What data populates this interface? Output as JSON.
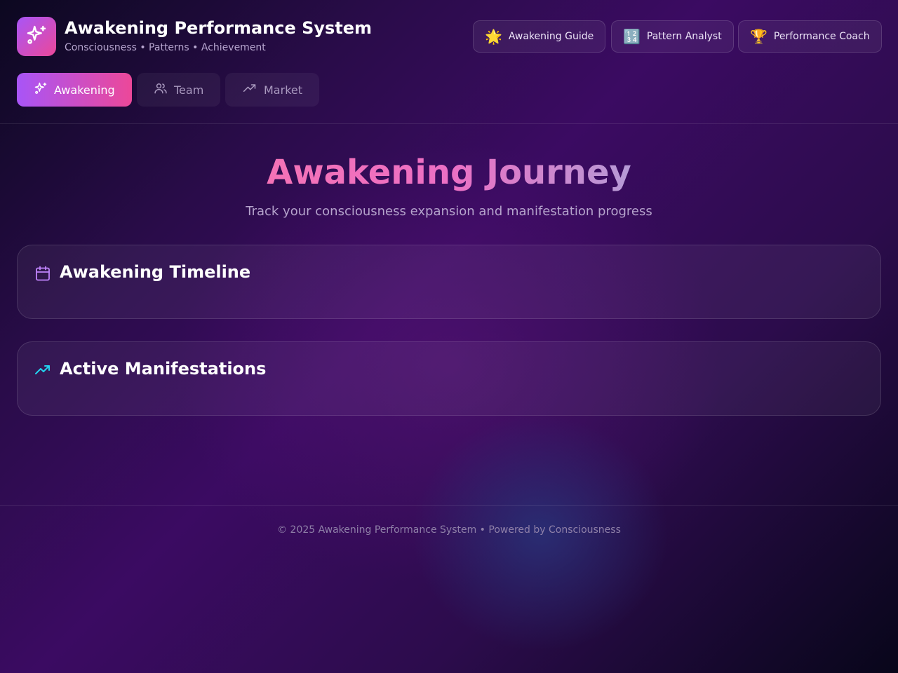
{
  "header": {
    "title": "Awakening Performance System",
    "subtitle": "Consciousness • Patterns • Achievement",
    "logo_icon": "sparkles-icon",
    "agents": [
      {
        "label": "Awakening Guide",
        "emoji": "🌟"
      },
      {
        "label": "Pattern Analyst",
        "emoji": "🔢"
      },
      {
        "label": "Performance Coach",
        "emoji": "🏆"
      }
    ],
    "tabs": [
      {
        "label": "Awakening",
        "icon": "sparkles-icon",
        "active": true
      },
      {
        "label": "Team",
        "icon": "users-icon",
        "active": false
      },
      {
        "label": "Market",
        "icon": "trending-up-icon",
        "active": false
      }
    ]
  },
  "main": {
    "title": "Awakening Journey",
    "subtitle": "Track your consciousness expansion and manifestation progress",
    "cards": [
      {
        "title": "Awakening Timeline",
        "icon": "calendar-icon",
        "icon_color": "#c084fc"
      },
      {
        "title": "Active Manifestations",
        "icon": "trending-up-icon",
        "icon_color": "#22d3ee"
      }
    ]
  },
  "footer": {
    "text": "© 2025 Awakening Performance System • Powered by Consciousness"
  },
  "colors": {
    "accent_start": "#a855f7",
    "accent_end": "#ec4899",
    "background": "#2a0c4a"
  }
}
